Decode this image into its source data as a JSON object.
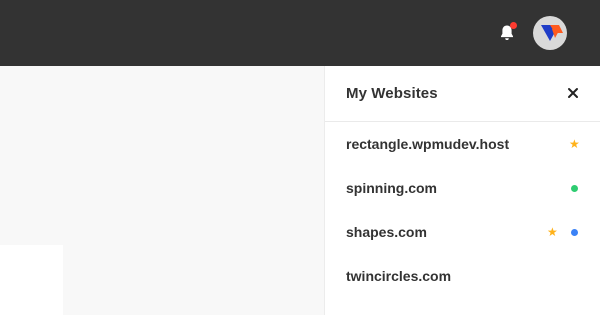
{
  "topbar": {
    "notification_icon": "bell-icon",
    "avatar_icon": "brand-logo-avatar"
  },
  "panel": {
    "title": "My Websites",
    "close_icon": "close-icon",
    "sites": [
      {
        "name": "rectangle.wpmudev.host",
        "starred": true,
        "status_color": null
      },
      {
        "name": "spinning.com",
        "starred": false,
        "status_color": "#2ecc71"
      },
      {
        "name": "shapes.com",
        "starred": true,
        "status_color": "#3b82f6"
      },
      {
        "name": "twincircles.com",
        "starred": false,
        "status_color": null
      }
    ]
  },
  "colors": {
    "topbar": "#333333",
    "star": "#ffb21a",
    "notification_dot": "#ff3b30",
    "logo_blue": "#1f3cc7",
    "logo_orange": "#ff5a1f"
  }
}
